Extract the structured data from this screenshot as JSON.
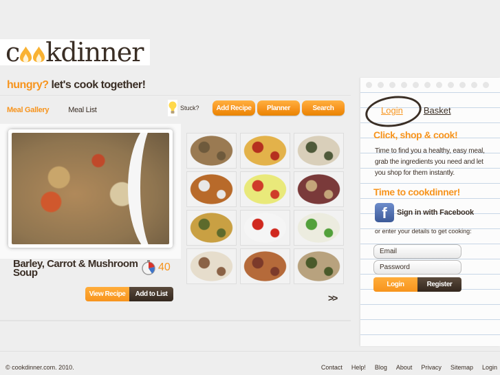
{
  "brand": {
    "logo_prefix": "c",
    "logo_suffix": "kdinner",
    "logo_full": "cookdinner",
    "tagline_highlight": "hungry?",
    "tagline_rest": "let's cook together!",
    "colors": {
      "accent": "#f7941d",
      "dark": "#3a2e25",
      "background": "#eeeeee"
    }
  },
  "tabs": [
    {
      "label": "Meal Gallery",
      "active": true
    },
    {
      "label": "Meal List",
      "active": false
    }
  ],
  "stuck": {
    "icon": "lightbulb-icon",
    "label": "Stuck?"
  },
  "nav_buttons": [
    {
      "label": "Add Recipe"
    },
    {
      "label": "Planner"
    },
    {
      "label": "Search"
    }
  ],
  "featured": {
    "title": "Barley, Carrot & Mushroom Soup",
    "time_icon": "stopwatch-icon",
    "time": "40",
    "view_label": "View Recipe",
    "add_label": "Add to List"
  },
  "gallery": {
    "thumbnails": [
      {
        "name": "barley-soup",
        "colors": [
          "#9a7a52",
          "#6e5a3c"
        ]
      },
      {
        "name": "penne-tomato",
        "colors": [
          "#e3b24a",
          "#b5301f"
        ]
      },
      {
        "name": "penne-spinach",
        "colors": [
          "#d9cfba",
          "#4f5a3a"
        ]
      },
      {
        "name": "bean-stew",
        "colors": [
          "#b86a2a",
          "#e8e8e8"
        ]
      },
      {
        "name": "salad",
        "colors": [
          "#e9e97a",
          "#cf3b2a"
        ]
      },
      {
        "name": "beef-stew",
        "colors": [
          "#7a3a3a",
          "#c4a57a"
        ]
      },
      {
        "name": "rice-pilaf",
        "colors": [
          "#c9a043",
          "#5d6a2c"
        ]
      },
      {
        "name": "caprese-skewers",
        "colors": [
          "#f5f5f5",
          "#d0281e"
        ]
      },
      {
        "name": "pea-risotto",
        "colors": [
          "#ececdf",
          "#52a03a"
        ]
      },
      {
        "name": "pasta-chicken",
        "colors": [
          "#e6ddcc",
          "#8a6246"
        ]
      },
      {
        "name": "chicken-curry",
        "colors": [
          "#b56a3a",
          "#7c3a2a"
        ]
      },
      {
        "name": "chicken-herb",
        "colors": [
          "#b8a27e",
          "#4a5a2a"
        ]
      }
    ],
    "next_label": ">>"
  },
  "sidebar": {
    "login_tab": "Login",
    "basket_tab": "Basket",
    "heading1": "Click, shop & cook!",
    "paragraph": "Time to find you a healthy, easy meal, grab the ingredients you need and let you shop for them instantly.",
    "heading2": "Time to cookdinner!",
    "facebook_label": "Sign in with Facebook",
    "facebook_icon": "f",
    "or_text": "or enter your details to get cooking:",
    "email_placeholder": "Email",
    "password_placeholder": "Password",
    "login_button": "Login",
    "register_button": "Register"
  },
  "footer": {
    "copyright": "© cookdinner.com.  2010.",
    "links": [
      "Contact",
      "Help!",
      "Blog",
      "About",
      "Privacy",
      "Sitemap",
      "Login"
    ]
  }
}
